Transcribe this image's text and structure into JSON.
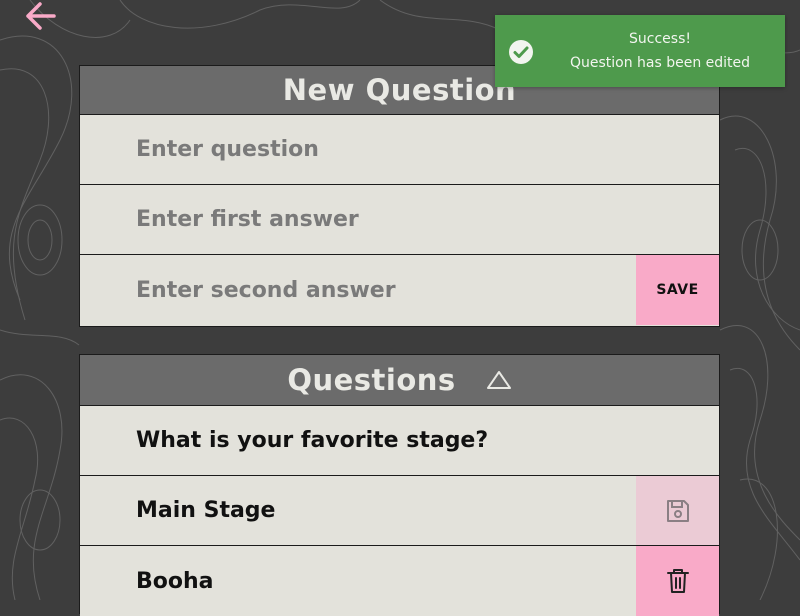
{
  "new_question": {
    "title": "New Question",
    "question_placeholder": "Enter question",
    "first_answer_placeholder": "Enter first answer",
    "second_answer_placeholder": "Enter second answer",
    "save_label": "SAVE"
  },
  "questions": {
    "title": "Questions",
    "question_text": "What is your favorite stage?",
    "answers": [
      "Main Stage",
      "Booha"
    ]
  },
  "toast": {
    "title": "Success!",
    "message": "Question has been edited"
  },
  "colors": {
    "accent_pink": "#f9aac8",
    "success_green": "#4e9a4c",
    "header_gray": "#6b6b6b",
    "background": "#3d3d3d"
  },
  "icons": [
    "back-arrow-icon",
    "collapse-triangle-icon",
    "save-disk-icon",
    "trash-icon",
    "check-circle-icon"
  ]
}
